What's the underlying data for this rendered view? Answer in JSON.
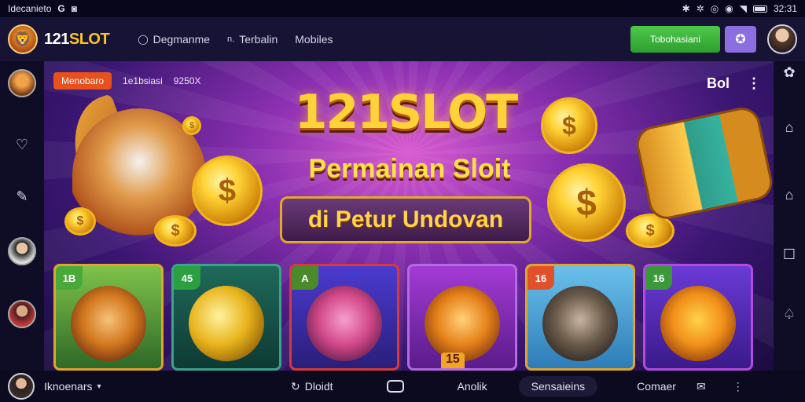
{
  "statusbar": {
    "left_text": "Idecanieto",
    "left_icon_text": "G",
    "time": "32:31"
  },
  "header": {
    "brand_prefix": "121",
    "brand_suffix": "SLOT",
    "nav": [
      {
        "label": "Degmanme",
        "icon": "circle-icon"
      },
      {
        "label": "Terbalin",
        "icon": "n-icon"
      },
      {
        "label": "Mobiles"
      }
    ],
    "cta_label": "Tobohasiani",
    "cta2_icon": "star-icon"
  },
  "hero": {
    "pill": "Menobaro",
    "chips": [
      "1e1bsiasi",
      "9250X"
    ],
    "menu_text": "Bol",
    "title": "121SLOT",
    "subtitle": "Permainan Sloit",
    "banner": "di Petur Undovan",
    "cards": [
      {
        "badge": "1B",
        "badge_color": "#4aa83a"
      },
      {
        "badge": "45",
        "badge_color": "#2aa040"
      },
      {
        "badge": "A",
        "badge_color": "#4a8a2a"
      },
      {
        "badge": "",
        "badge_color": "#7a2ab0"
      },
      {
        "badge": "16",
        "badge_color": "#e0502a"
      },
      {
        "badge": "16",
        "badge_color": "#3a9a3a"
      }
    ],
    "card_stamp": "15"
  },
  "bottombar": {
    "user": "Iknoenars",
    "items": [
      {
        "label": "Dloidt",
        "icon": "refresh-icon"
      },
      {
        "label": "",
        "icon": "home-icon"
      },
      {
        "label": "Anolik"
      },
      {
        "label": "Sensaieins"
      },
      {
        "label": "Comaer"
      }
    ]
  },
  "colors": {
    "accent_green": "#3cb43b",
    "accent_purple": "#8b6ee0",
    "gold": "#ffd23a"
  }
}
